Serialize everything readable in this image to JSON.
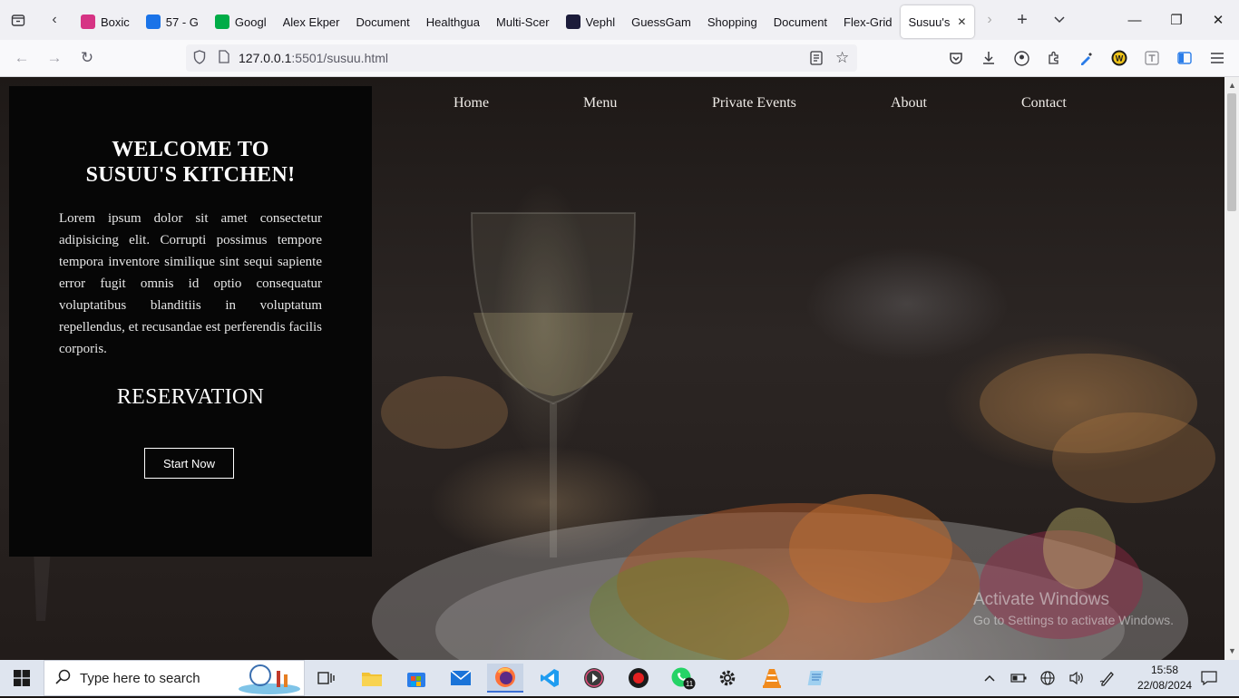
{
  "browser": {
    "tabs": [
      {
        "title": "Boxic",
        "favicon": "boxicons-icon",
        "color": "#d63384"
      },
      {
        "title": "57 - G",
        "favicon": "google-drive-icon",
        "color": "#1a73e8"
      },
      {
        "title": "Googl",
        "favicon": "google-meet-icon",
        "color": "#00ac47"
      },
      {
        "title": "Alex Ekper",
        "favicon": "",
        "color": ""
      },
      {
        "title": "Document",
        "favicon": "",
        "color": ""
      },
      {
        "title": "Healthgua",
        "favicon": "",
        "color": ""
      },
      {
        "title": "Multi-Scer",
        "favicon": "",
        "color": ""
      },
      {
        "title": "Vephl",
        "favicon": "vephla-icon",
        "color": "#1b1b3a"
      },
      {
        "title": "GuessGam",
        "favicon": "",
        "color": ""
      },
      {
        "title": "Shopping",
        "favicon": "",
        "color": ""
      },
      {
        "title": "Document",
        "favicon": "",
        "color": ""
      },
      {
        "title": "Flex-Grid",
        "favicon": "",
        "color": ""
      },
      {
        "title": "Susuu's",
        "favicon": "",
        "color": "",
        "active": true
      }
    ],
    "url_host": "127.0.0.1",
    "url_path": ":5501/susuu.html"
  },
  "site": {
    "nav": [
      "Home",
      "Menu",
      "Private Events",
      "About",
      "Contact"
    ],
    "hero_title_line1": "WELCOME TO",
    "hero_title_line2": "SUSUU'S KITCHEN!",
    "hero_text": "Lorem ipsum dolor sit amet consectetur adipisicing elit. Corrupti possimus tempore tempora inventore similique sint sequi sapiente error fugit omnis id optio consequatur voluptatibus blanditiis in voluptatum repellendus, et recusandae est perferendis facilis corporis.",
    "reservation_heading": "RESERVATION",
    "cta_label": "Start Now"
  },
  "watermark": {
    "line1": "Activate Windows",
    "line2": "Go to Settings to activate Windows."
  },
  "taskbar": {
    "search_placeholder": "Type here to search",
    "whatsapp_badge": "11",
    "time": "15:58",
    "date": "22/08/2024"
  }
}
